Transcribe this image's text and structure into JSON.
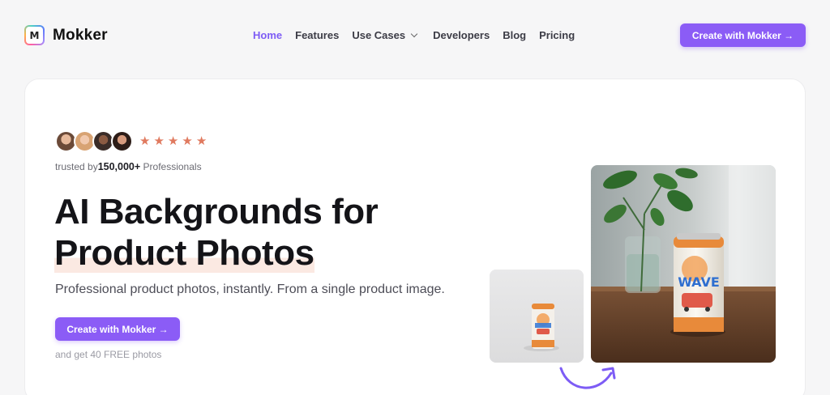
{
  "brand": {
    "logo_letter": "M",
    "name": "Mokker"
  },
  "nav": {
    "items": [
      {
        "label": "Home",
        "active": true
      },
      {
        "label": "Features"
      },
      {
        "label": "Use Cases",
        "has_dropdown": true
      },
      {
        "label": "Developers"
      },
      {
        "label": "Blog"
      },
      {
        "label": "Pricing"
      }
    ],
    "cta_label": "Create with Mokker →"
  },
  "hero": {
    "rating_stars": 5,
    "star_glyph": "★",
    "trusted_prefix": "trusted by",
    "trusted_count": "150,000+",
    "trusted_suffix": "Professionals",
    "headline_line1": "AI Backgrounds for",
    "headline_line2": "Product Photos",
    "subtitle": "Professional product photos, instantly. From a single product image.",
    "cta_label": "Create with Mokker →",
    "free_note": "and get 40 FREE photos"
  },
  "images": {
    "before_alt": "product-can-plain-background",
    "after_alt": "product-can-with-plant-scene",
    "can_label": "WAVE"
  },
  "colors": {
    "accent": "#8b5cf6",
    "active_nav": "#7d5cf5",
    "star": "#e07a5f",
    "highlight": "#fbe9e2"
  }
}
